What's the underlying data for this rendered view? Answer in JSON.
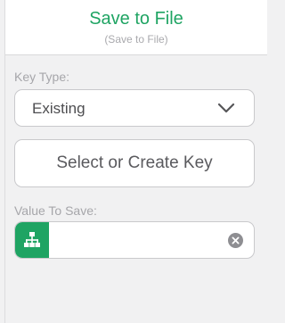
{
  "header": {
    "title": "Save to File",
    "subtitle": "(Save to File)"
  },
  "key_type": {
    "label": "Key Type:",
    "selected": "Existing"
  },
  "select_key_button": {
    "label": "Select or Create Key"
  },
  "value_to_save": {
    "label": "Value To Save:",
    "value": ""
  },
  "colors": {
    "accent": "#1fa463",
    "background": "#f1f1f2",
    "label": "#a6a6aa"
  },
  "icons": {
    "dropdown": "chevron-down-icon",
    "value_source": "hierarchy-icon",
    "clear": "clear-icon"
  }
}
